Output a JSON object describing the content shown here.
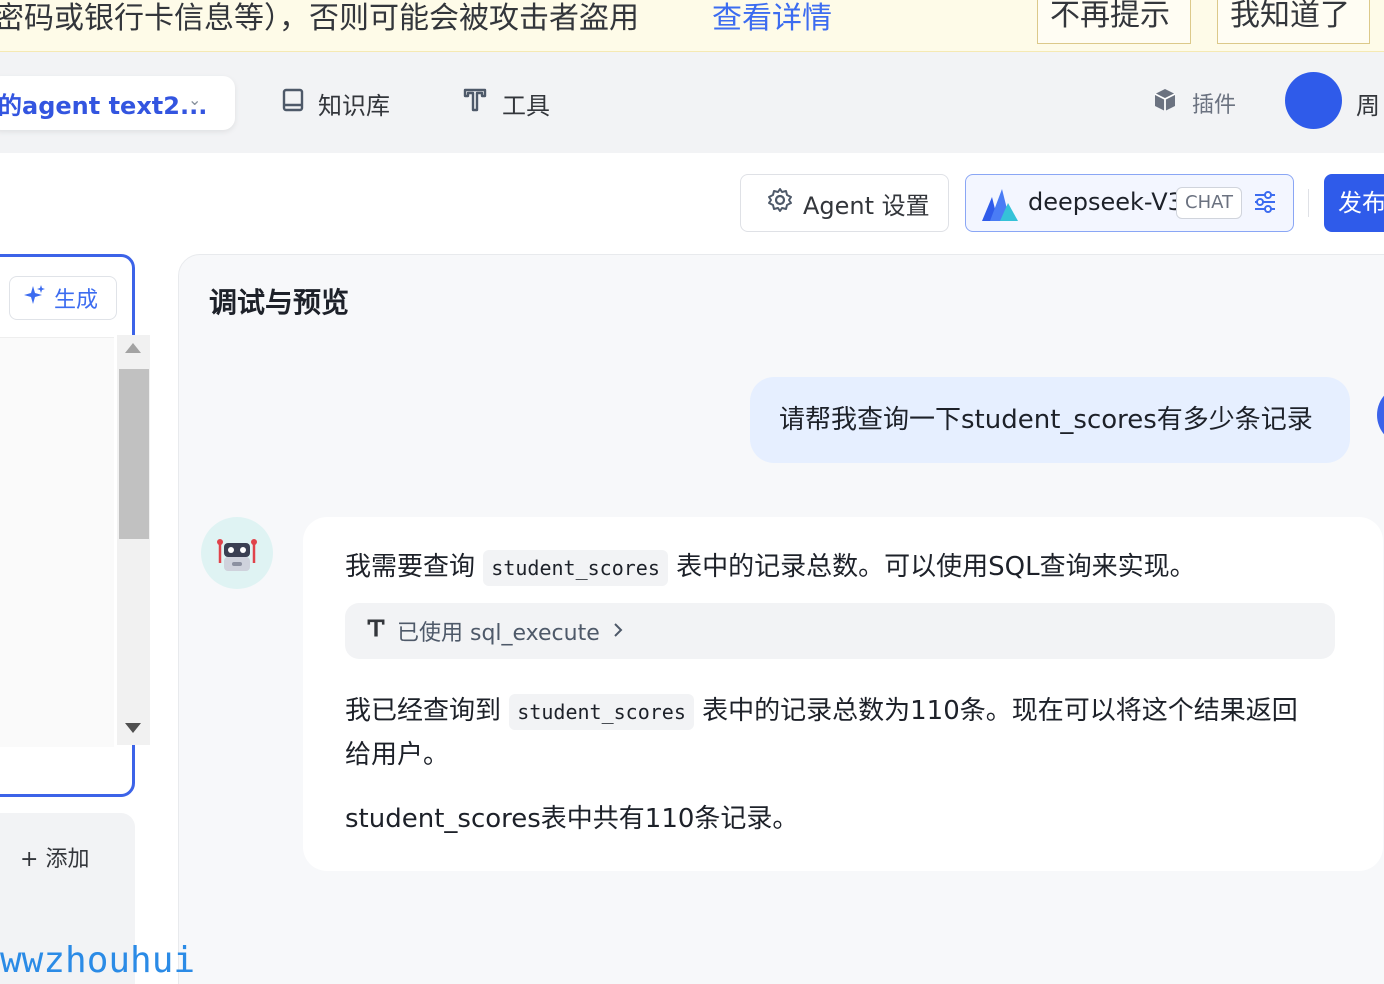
{
  "banner": {
    "text": "密码或银行卡信息等），否则可能会被攻击者盗用",
    "link": "查看详情",
    "dismiss_button": "不再提示",
    "ok_button": "我知道了"
  },
  "nav": {
    "agent_name": "的agent text2...",
    "knowledge_base": "知识库",
    "tools": "工具",
    "plugins": "插件",
    "user_name": "周"
  },
  "toolbar": {
    "agent_settings": "Agent 设置",
    "model_name": "deepseek-V3",
    "model_tag": "CHAT",
    "publish": "发布"
  },
  "left_panel": {
    "generate": "生成",
    "add": "添加"
  },
  "watermark": "wwzhouhui",
  "preview": {
    "title": "调试与预览",
    "user_message": "请帮我查询一下student_scores有多少条记录",
    "bot": {
      "line1_before": "我需要查询",
      "line1_code": "student_scores",
      "line1_after": "表中的记录总数。可以使用SQL查询来实现。",
      "tool_used": "已使用 sql_execute",
      "line2_before": "我已经查询到",
      "line2_code": "student_scores",
      "line2_after": "表中的记录总数为110条。现在可以将这个结果返回",
      "line3": "给用户。",
      "line4": "student_scores表中共有110条记录。"
    }
  },
  "colors": {
    "primary": "#2f5bea",
    "link": "#3c6cf0",
    "banner_bg": "#fefbe8",
    "user_bubble": "#e6efff"
  },
  "icons": {
    "knowledge_base": "book-icon",
    "tools": "tool-icon",
    "plugins": "cube-icon",
    "agent_settings": "gear-icon",
    "model_adjust": "sliders-icon",
    "generate": "sparkle-icon"
  }
}
